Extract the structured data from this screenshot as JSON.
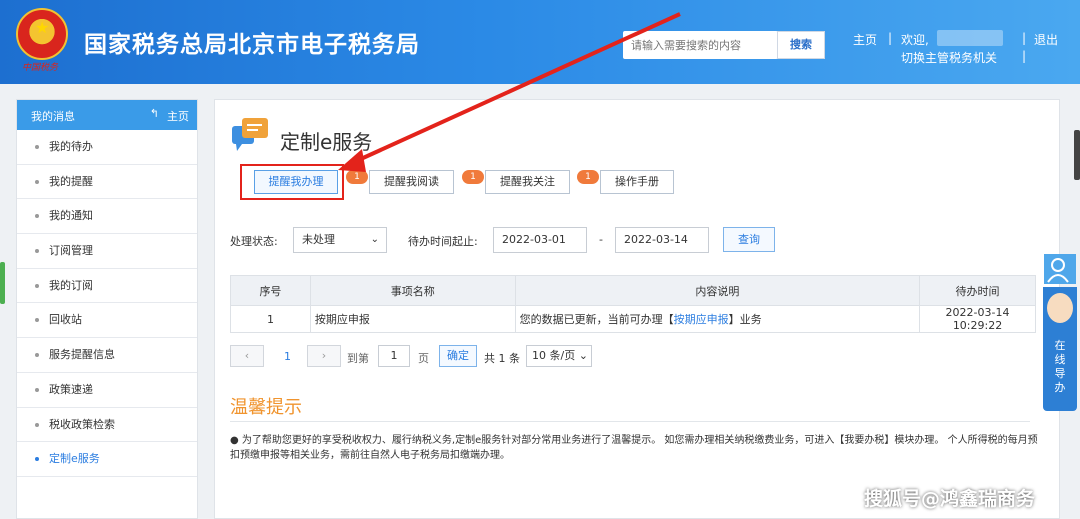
{
  "header": {
    "title": "国家税务总局北京市电子税务局",
    "emblem_text": "中国税务",
    "search_placeholder": "请输入需要搜索的内容",
    "search_button": "搜索",
    "home_link": "主页",
    "welcome": "欢迎,",
    "logout": "退出",
    "switch_office": "切换主管税务机关"
  },
  "sidebar": {
    "header_title": "我的消息",
    "home_label": "主页",
    "items": [
      {
        "label": "我的待办"
      },
      {
        "label": "我的提醒"
      },
      {
        "label": "我的通知"
      },
      {
        "label": "订阅管理"
      },
      {
        "label": "我的订阅"
      },
      {
        "label": "回收站"
      },
      {
        "label": "服务提醒信息"
      },
      {
        "label": "政策速递"
      },
      {
        "label": "税收政策检索"
      },
      {
        "label": "定制e服务"
      }
    ],
    "active_index": 9
  },
  "main": {
    "title": "定制e服务",
    "tabs": [
      {
        "label": "提醒我办理",
        "badge": "1"
      },
      {
        "label": "提醒我阅读",
        "badge": "1"
      },
      {
        "label": "提醒我关注",
        "badge": "1"
      },
      {
        "label": "操作手册"
      }
    ],
    "filter": {
      "status_label": "处理状态:",
      "status_value": "未处理",
      "date_label": "待办时间起止:",
      "date_from": "2022-03-01",
      "date_sep": "-",
      "date_to": "2022-03-14",
      "query_button": "查询"
    },
    "table": {
      "headers": [
        "序号",
        "事项名称",
        "内容说明",
        "待办时间"
      ],
      "rows": [
        {
          "index": "1",
          "name": "按期应申报",
          "desc_prefix": "您的数据已更新，当前可办理【",
          "desc_link": "按期应申报",
          "desc_suffix": "】业务",
          "time": "2022-03-14 10:29:22"
        }
      ]
    },
    "pager": {
      "prev": "‹",
      "current_page": "1",
      "next": "›",
      "goto_label": "到第",
      "goto_value": "1",
      "page_unit": "页",
      "confirm": "确定",
      "total": "共 1 条",
      "page_size": "10 条/页"
    },
    "tips": {
      "title": "温馨提示",
      "text": "● 为了帮助您更好的享受税收权力、履行纳税义务,定制e服务针对部分常用业务进行了温馨提示。 如您需办理相关纳税缴费业务，可进入【我要办税】模块办理。 个人所得税的每月预扣预缴申报等相关业务，需前往自然人电子税务局扣缴端办理。"
    }
  },
  "side_widget": {
    "guide_text": "在线导办"
  },
  "watermark": "搜狐号@鸿鑫瑞商务"
}
